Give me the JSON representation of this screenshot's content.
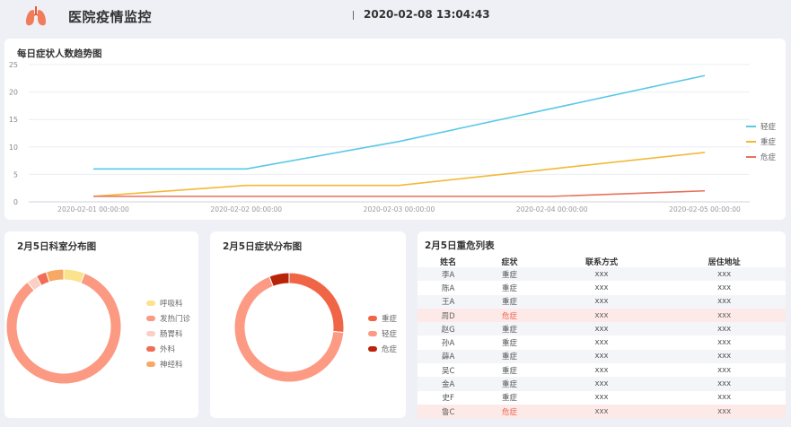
{
  "header": {
    "title": "医院疫情监控",
    "datetime": "2020-02-08 13:04:43",
    "logo_icon": "lungs-icon"
  },
  "trend": {
    "title": "每日症状人数趋势图",
    "chart_data": {
      "type": "line",
      "x": [
        "2020-02-01 00:00:00",
        "2020-02-02 00:00:00",
        "2020-02-03 00:00:00",
        "2020-02-04 00:00:00",
        "2020-02-05 00:00:00"
      ],
      "series": [
        {
          "name": "轻症",
          "color": "#5bc8e6",
          "values": [
            6,
            6,
            11,
            17,
            23
          ]
        },
        {
          "name": "重症",
          "color": "#f2b937",
          "values": [
            1,
            3,
            3,
            6,
            9
          ]
        },
        {
          "name": "危症",
          "color": "#e8715c",
          "values": [
            1,
            1,
            1,
            1,
            2
          ]
        }
      ],
      "ylim": [
        0,
        25
      ],
      "yticks": [
        0,
        5,
        10,
        15,
        20,
        25
      ],
      "grid": true,
      "legend": "right"
    }
  },
  "dept": {
    "title": "2月5日科室分布图",
    "chart_data": {
      "type": "pie",
      "style": "donut",
      "categories": [
        "呼吸科",
        "发热门诊",
        "肠胃科",
        "外科",
        "神经科"
      ],
      "colors": [
        "#fbe38e",
        "#fc9982",
        "#fbcfc4",
        "#f06e55",
        "#f8a865"
      ],
      "values": [
        6,
        84,
        3,
        3,
        5
      ],
      "legend": "right"
    }
  },
  "symptom": {
    "title": "2月5日症状分布图",
    "chart_data": {
      "type": "pie",
      "style": "donut",
      "categories": [
        "重症",
        "轻症",
        "危症"
      ],
      "colors": [
        "#f06545",
        "#fc9a83",
        "#b8240a"
      ],
      "values": [
        9,
        23,
        2
      ],
      "legend": "right"
    }
  },
  "critical": {
    "title": "2月5日重危列表",
    "columns": [
      "姓名",
      "症状",
      "联系方式",
      "居住地址"
    ],
    "rows": [
      {
        "name": "李A",
        "symptom": "重症",
        "contact": "xxx",
        "address": "xxx"
      },
      {
        "name": "陈A",
        "symptom": "重症",
        "contact": "xxx",
        "address": "xxx"
      },
      {
        "name": "王A",
        "symptom": "重症",
        "contact": "xxx",
        "address": "xxx"
      },
      {
        "name": "周D",
        "symptom": "危症",
        "contact": "xxx",
        "address": "xxx"
      },
      {
        "name": "赵G",
        "symptom": "重症",
        "contact": "xxx",
        "address": "xxx"
      },
      {
        "name": "孙A",
        "symptom": "重症",
        "contact": "xxx",
        "address": "xxx"
      },
      {
        "name": "薛A",
        "symptom": "重症",
        "contact": "xxx",
        "address": "xxx"
      },
      {
        "name": "吴C",
        "symptom": "重症",
        "contact": "xxx",
        "address": "xxx"
      },
      {
        "name": "金A",
        "symptom": "重症",
        "contact": "xxx",
        "address": "xxx"
      },
      {
        "name": "史F",
        "symptom": "重症",
        "contact": "xxx",
        "address": "xxx"
      },
      {
        "name": "鲁C",
        "symptom": "危症",
        "contact": "xxx",
        "address": "xxx"
      }
    ],
    "alert_symptom": "危症",
    "alert_color": "#e86452"
  }
}
